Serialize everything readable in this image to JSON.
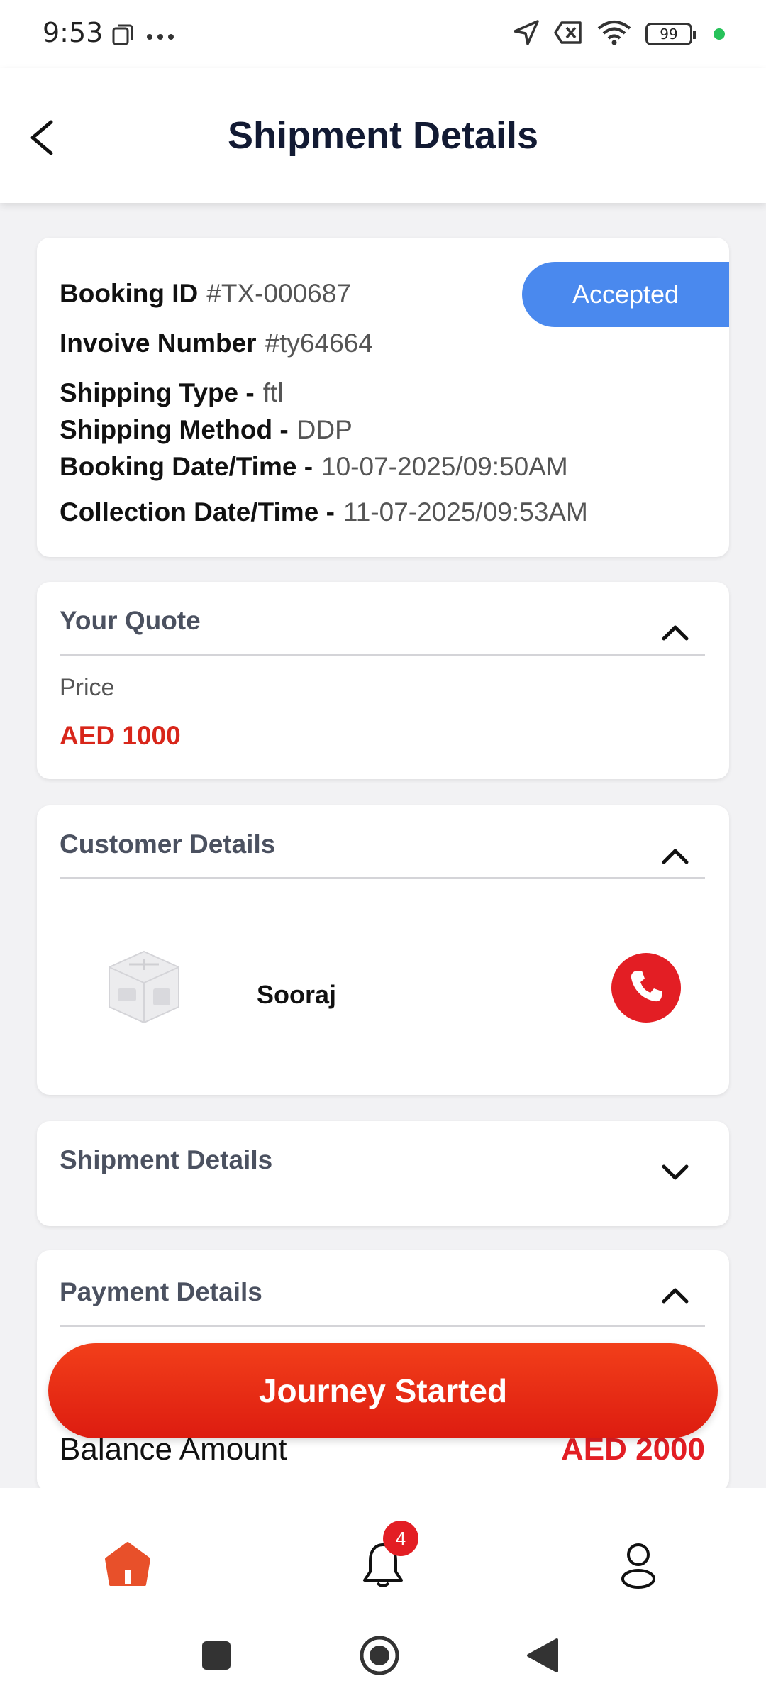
{
  "status_bar": {
    "time": "9:53",
    "battery": "99"
  },
  "header": {
    "title": "Shipment Details"
  },
  "booking": {
    "booking_id_label": "Booking ID",
    "booking_id": "#TX-000687",
    "invoice_label": "Invoive Number",
    "invoice": "#ty64664",
    "shipping_type_label": "Shipping Type -",
    "shipping_type": "ftl",
    "shipping_method_label": "Shipping Method -",
    "shipping_method": "DDP",
    "booking_date_label": "Booking Date/Time -",
    "booking_date": "10-07-2025/09:50AM",
    "collection_date_label": "Collection Date/Time -",
    "collection_date": "11-07-2025/09:53AM",
    "status": "Accepted",
    "status_color": "#4a89ee"
  },
  "quote": {
    "title": "Your Quote",
    "price_label": "Price",
    "price_value": "AED 1000"
  },
  "customer": {
    "title": "Customer Details",
    "name": "Sooraj"
  },
  "shipment_section": {
    "title": "Shipment Details"
  },
  "payment": {
    "title": "Payment Details",
    "balance_label": "Balance Amount",
    "balance_value": "AED 2000"
  },
  "action": {
    "label": "Journey Started",
    "color": "#e6261a"
  },
  "bottom_nav": {
    "home_icon": "home-icon",
    "notifications_icon": "bell-icon",
    "notification_count": "4",
    "profile_icon": "user-icon"
  }
}
